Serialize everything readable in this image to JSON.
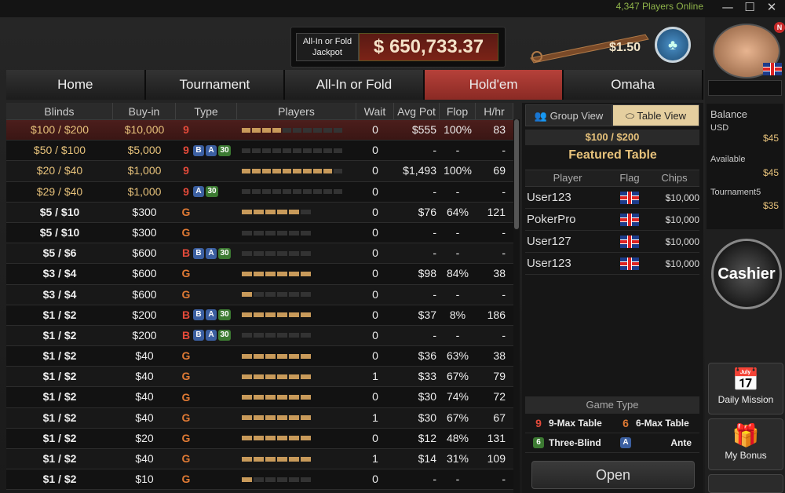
{
  "window": {
    "online": "4,347 Players Online"
  },
  "jackpot": {
    "label": "All-In or Fold Jackpot",
    "amount": "$ 650,733.37"
  },
  "cue_value": "$1.50",
  "tabs": [
    "Home",
    "Tournament",
    "All-In or Fold",
    "Hold'em",
    "Omaha"
  ],
  "active_tab": 3,
  "columns": [
    "Blinds",
    "Buy-in",
    "Type",
    "Players",
    "Wait",
    "Avg Pot",
    "Flop",
    "H/hr"
  ],
  "rows": [
    {
      "blinds": "$100 / $200",
      "buyin": "$10,000",
      "type": [
        "9"
      ],
      "players": [
        4,
        10
      ],
      "wait": "0",
      "avg": "$555",
      "flop": "100%",
      "hhr": "83",
      "gold": true
    },
    {
      "blinds": "$50 / $100",
      "buyin": "$5,000",
      "type": [
        "9",
        "B",
        "A",
        "30"
      ],
      "players": [
        0,
        10
      ],
      "wait": "0",
      "avg": "-",
      "flop": "-",
      "hhr": "-",
      "gold": true
    },
    {
      "blinds": "$20 / $40",
      "buyin": "$1,000",
      "type": [
        "9"
      ],
      "players": [
        9,
        10
      ],
      "wait": "0",
      "avg": "$1,493",
      "flop": "100%",
      "hhr": "69",
      "gold": true
    },
    {
      "blinds": "$29 / $40",
      "buyin": "$1,000",
      "type": [
        "9",
        "A",
        "30"
      ],
      "players": [
        0,
        10
      ],
      "wait": "0",
      "avg": "-",
      "flop": "-",
      "hhr": "-",
      "gold": true
    },
    {
      "blinds": "$5 / $10",
      "buyin": "$300",
      "type": [
        "G"
      ],
      "players": [
        5,
        6
      ],
      "wait": "0",
      "avg": "$76",
      "flop": "64%",
      "hhr": "121",
      "gold": false
    },
    {
      "blinds": "$5 / $10",
      "buyin": "$300",
      "type": [
        "G"
      ],
      "players": [
        0,
        6
      ],
      "wait": "0",
      "avg": "-",
      "flop": "-",
      "hhr": "-",
      "gold": false
    },
    {
      "blinds": "$5 / $6",
      "buyin": "$600",
      "type": [
        "B",
        "B",
        "A",
        "30"
      ],
      "players": [
        0,
        6
      ],
      "wait": "0",
      "avg": "-",
      "flop": "-",
      "hhr": "-",
      "gold": false
    },
    {
      "blinds": "$3 / $4",
      "buyin": "$600",
      "type": [
        "G"
      ],
      "players": [
        6,
        6
      ],
      "wait": "0",
      "avg": "$98",
      "flop": "84%",
      "hhr": "38",
      "gold": false
    },
    {
      "blinds": "$3 / $4",
      "buyin": "$600",
      "type": [
        "G"
      ],
      "players": [
        1,
        6
      ],
      "wait": "0",
      "avg": "-",
      "flop": "-",
      "hhr": "-",
      "gold": false
    },
    {
      "blinds": "$1 / $2",
      "buyin": "$200",
      "type": [
        "B",
        "B",
        "A",
        "30"
      ],
      "players": [
        6,
        6
      ],
      "wait": "0",
      "avg": "$37",
      "flop": "8%",
      "hhr": "186",
      "gold": false
    },
    {
      "blinds": "$1 / $2",
      "buyin": "$200",
      "type": [
        "B",
        "B",
        "A",
        "30"
      ],
      "players": [
        0,
        6
      ],
      "wait": "0",
      "avg": "-",
      "flop": "-",
      "hhr": "-",
      "gold": false
    },
    {
      "blinds": "$1 / $2",
      "buyin": "$40",
      "type": [
        "G"
      ],
      "players": [
        6,
        6
      ],
      "wait": "0",
      "avg": "$36",
      "flop": "63%",
      "hhr": "38",
      "gold": false
    },
    {
      "blinds": "$1 / $2",
      "buyin": "$40",
      "type": [
        "G"
      ],
      "players": [
        6,
        6
      ],
      "wait": "1",
      "avg": "$33",
      "flop": "67%",
      "hhr": "79",
      "gold": false
    },
    {
      "blinds": "$1 / $2",
      "buyin": "$40",
      "type": [
        "G"
      ],
      "players": [
        6,
        6
      ],
      "wait": "0",
      "avg": "$30",
      "flop": "74%",
      "hhr": "72",
      "gold": false
    },
    {
      "blinds": "$1 / $2",
      "buyin": "$40",
      "type": [
        "G"
      ],
      "players": [
        6,
        6
      ],
      "wait": "1",
      "avg": "$30",
      "flop": "67%",
      "hhr": "67",
      "gold": false
    },
    {
      "blinds": "$1 / $2",
      "buyin": "$20",
      "type": [
        "G"
      ],
      "players": [
        6,
        6
      ],
      "wait": "0",
      "avg": "$12",
      "flop": "48%",
      "hhr": "131",
      "gold": false
    },
    {
      "blinds": "$1 / $2",
      "buyin": "$40",
      "type": [
        "G"
      ],
      "players": [
        6,
        6
      ],
      "wait": "1",
      "avg": "$14",
      "flop": "31%",
      "hhr": "109",
      "gold": false
    },
    {
      "blinds": "$1 / $2",
      "buyin": "$10",
      "type": [
        "G"
      ],
      "players": [
        1,
        6
      ],
      "wait": "0",
      "avg": "-",
      "flop": "-",
      "hhr": "-",
      "gold": false
    }
  ],
  "featured": {
    "group_view": "Group View",
    "table_view": "Table View",
    "blinds": "$100 / $200",
    "title": "Featured Table",
    "headers": [
      "Player",
      "Flag",
      "Chips"
    ],
    "players": [
      {
        "name": "User123",
        "chips": "$10,000"
      },
      {
        "name": "PokerPro",
        "chips": "$10,000"
      },
      {
        "name": "User127",
        "chips": "$10,000"
      },
      {
        "name": "User123",
        "chips": "$10,000"
      }
    ],
    "game_type_title": "Game Type",
    "game_types": [
      {
        "icon": "9",
        "label": "9-Max Table"
      },
      {
        "icon": "6",
        "label": "6-Max Table"
      },
      {
        "icon": "6",
        "label": "Three-Blind"
      },
      {
        "icon": "A",
        "label": "Ante"
      }
    ],
    "open": "Open"
  },
  "balance": {
    "label": "Balance",
    "usd_label": "USD",
    "usd": "$45",
    "available_label": "Available",
    "available": "$45",
    "tourn_label": "Tournament5",
    "tourn": "$35"
  },
  "cashier": "Cashier",
  "daily_mission": "Daily Mission",
  "my_bonus": "My Bonus",
  "badge_new": "N"
}
